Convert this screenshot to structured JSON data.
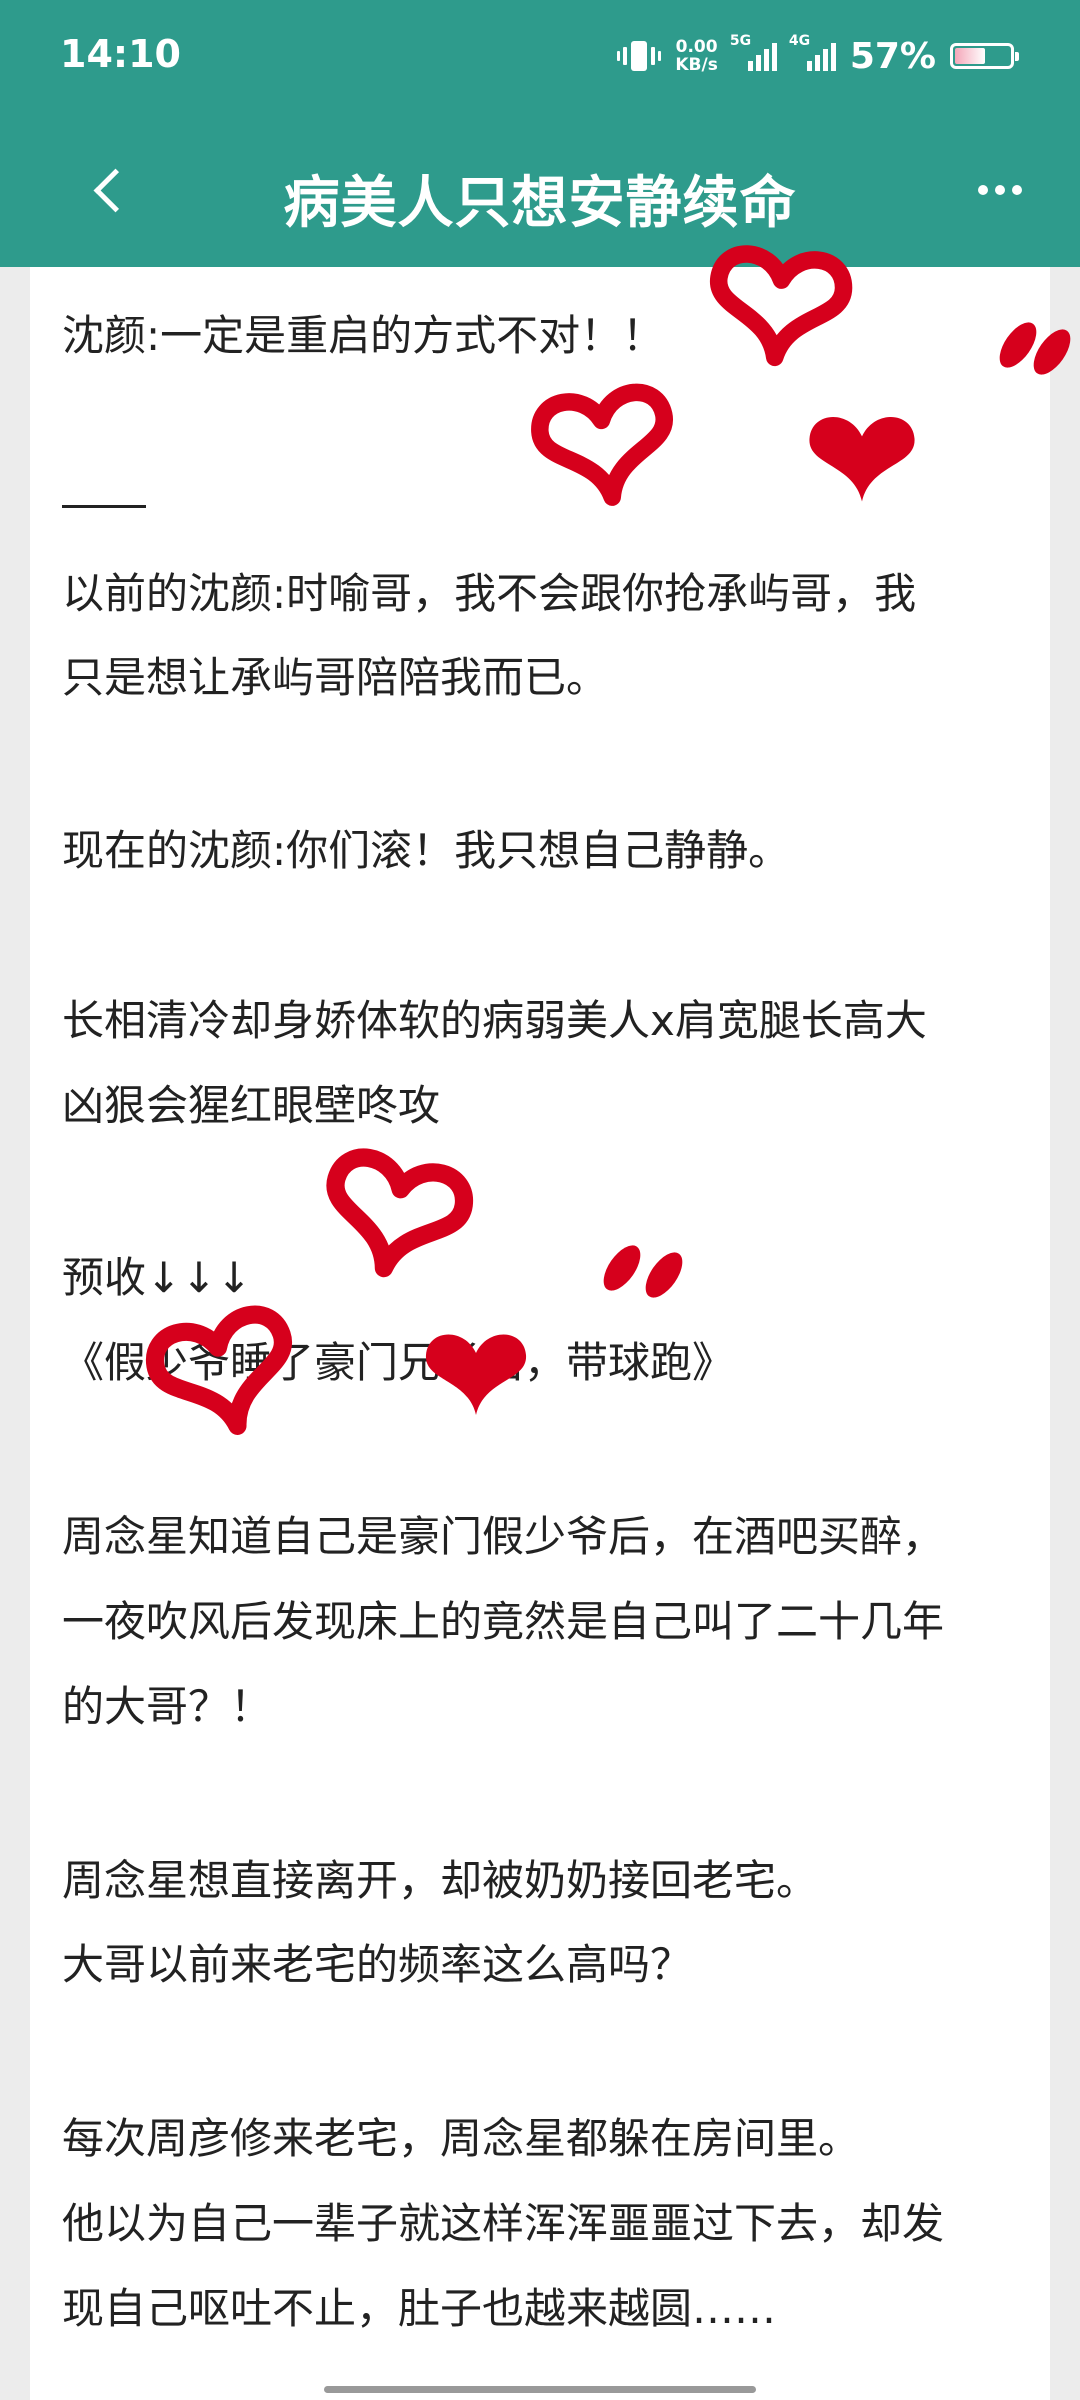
{
  "status_bar": {
    "time": "14:10",
    "net_speed_value": "0.00",
    "net_speed_unit": "KB/s",
    "sim1_type": "5G",
    "sim2_type": "4G",
    "battery_percent": "57%",
    "battery_level": 0.57
  },
  "app_bar": {
    "title": "病美人只想安静续命",
    "back_icon": "chevron-left-icon",
    "more_icon": "more-horizontal-icon",
    "background_color": "#2e9b8c"
  },
  "content": {
    "lines": [
      "沈颜:一定是重启的方式不对！！",
      "以前的沈颜:时喻哥，我不会跟你抢承屿哥，我",
      "只是想让承屿哥陪陪我而已。",
      "现在的沈颜:你们滚！我只想自己静静。",
      "长相清冷却身娇体软的病弱美人x肩宽腿长高大",
      "凶狠会猩红眼壁咚攻",
      "预收↓↓↓",
      "《假少爷睡了豪门兄长后，带球跑》",
      "周念星知道自己是豪门假少爷后，在酒吧买醉，",
      "一夜吹风后发现床上的竟然是自己叫了二十几年",
      "的大哥？！",
      "周念星想直接离开，却被奶奶接回老宅。",
      "大哥以前来老宅的频率这么高吗？",
      "每次周彦修来老宅，周念星都躲在房间里。",
      "他以为自己一辈子就这样浑浑噩噩过下去，却发",
      "现自己呕吐不止，肚子也越来越圆……"
    ]
  },
  "decoration": {
    "heart_color": "#d6001c"
  }
}
